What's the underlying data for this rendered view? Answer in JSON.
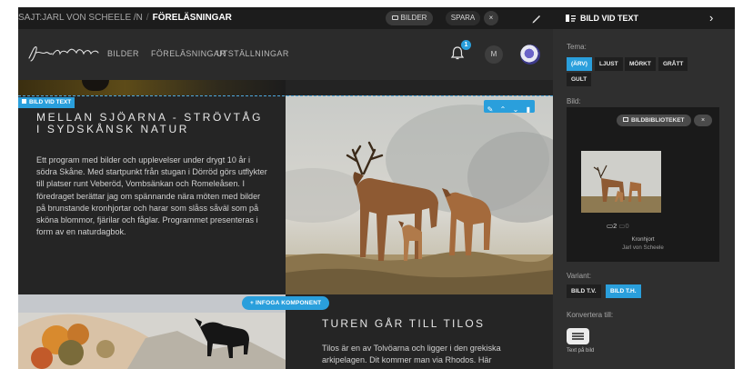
{
  "topbar": {
    "site": "SAJT:JARL VON SCHEELE /N",
    "separator": "/",
    "current": "FÖRELÄSNINGAR",
    "images_button": "BILDER",
    "save_button": "SPARA",
    "close_label": "×"
  },
  "header": {
    "logo_alt": "Jarl von Scheele",
    "nav": [
      "BILDER",
      "FÖRELÄSNINGAR",
      "UTSTÄLLNINGAR"
    ],
    "notification_count": "1",
    "user_initial": "M"
  },
  "content": {
    "block_tag": "BILD VID TEXT",
    "block1": {
      "title": "MELLAN SJÖARNA - STRÖVTÅG I SYDSKÅNSK NATUR",
      "body": "Ett program med bilder och upplevelser under drygt 10 år i södra Skåne. Med startpunkt från stugan i Dörröd görs utflykter till platser runt Veberöd, Vombsänkan och Romeleåsen. I föredraget berättar jag om spännande nära möten med bilder på brunstande kronhjortar och harar som slåss såväl som på sköna blommor, fjärilar och fåglar. Programmet presenteras i form av en naturdagbok."
    },
    "insert_button": "+ INFOGA KOMPONENT",
    "block2": {
      "title": "TUREN GÅR TILL TILOS",
      "body": "Tilos är en av Tolvöarna och ligger i den grekiska arkipelagen. Dit kommer man via Rhodos. Här"
    }
  },
  "panel": {
    "title": "BILD VID TEXT",
    "theme_label": "Tema:",
    "themes": [
      {
        "label": "(ÄRV)",
        "active": true
      },
      {
        "label": "LJUST",
        "active": false
      },
      {
        "label": "MÖRKT",
        "active": false
      },
      {
        "label": "GRÅTT",
        "active": false
      },
      {
        "label": "GULT",
        "active": false
      }
    ],
    "image_label": "Bild:",
    "library_button": "BILDBIBLIOTEKET",
    "library_close": "×",
    "image_count": "2",
    "image_count_dim": "0",
    "image_caption": "Kronhjort",
    "image_credit": "Jarl von Scheele",
    "variant_label": "Variant:",
    "variants": [
      {
        "label": "BILD T.V.",
        "active": false
      },
      {
        "label": "BILD T.H.",
        "active": true
      }
    ],
    "convert_label": "Konvertera till:",
    "convert_option": "Text på bild"
  },
  "colors": {
    "accent": "#2a9fdc",
    "panel_bg": "#2f2f2f",
    "topbar_bg": "#1c1c1c",
    "content_bg": "#252525"
  }
}
